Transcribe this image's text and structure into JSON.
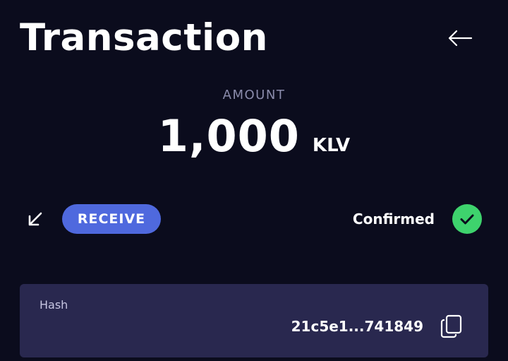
{
  "header": {
    "title": "Transaction",
    "back_icon": "arrow-left-icon"
  },
  "amount": {
    "label": "AMOUNT",
    "value": "1,000",
    "unit": "KLV"
  },
  "transaction": {
    "direction_icon": "arrow-down-left-icon",
    "type_label": "RECEIVE",
    "status_label": "Confirmed",
    "status_icon": "check-circle-icon"
  },
  "hash": {
    "label": "Hash",
    "value": "21c5e1...741849",
    "copy_icon": "copy-icon"
  },
  "colors": {
    "background": "#0b0c1d",
    "badge": "#4f69de",
    "success": "#3ed36d",
    "card": "#29284f",
    "muted": "#8a8bab"
  }
}
